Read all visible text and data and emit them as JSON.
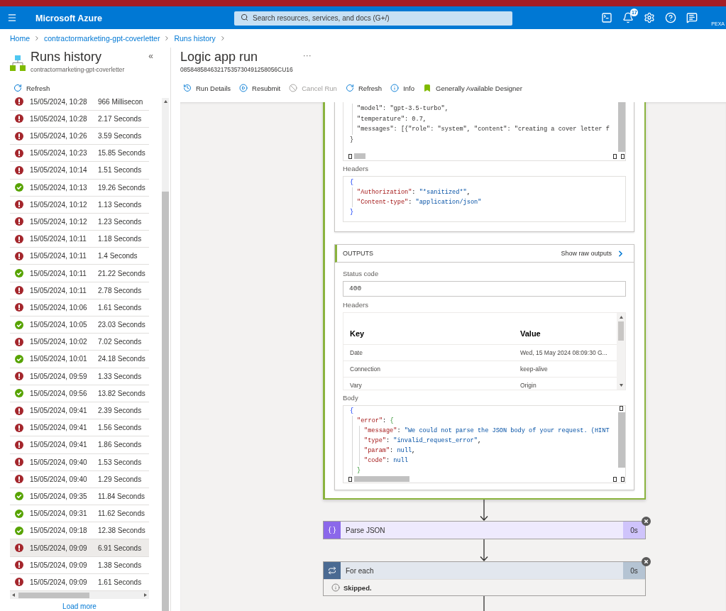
{
  "header": {
    "brand": "Microsoft Azure",
    "search": {
      "placeholder": "Search resources, services, and docs (G+/)"
    },
    "notification_count": "17",
    "account": "PEXA"
  },
  "breadcrumb": [
    "Home",
    "contractormarketing-gpt-coverletter",
    "Runs history"
  ],
  "runs_panel": {
    "title": "Runs history",
    "subtitle": "contractormarketing-gpt-coverletter",
    "collapse": "«",
    "refresh": "Refresh",
    "runs": [
      {
        "kind": "failed",
        "date": "15/05/2024, 10:28",
        "duration": "966 Millisecon",
        "selected": false
      },
      {
        "kind": "failed",
        "date": "15/05/2024, 10:28",
        "duration": "2.17 Seconds",
        "selected": false
      },
      {
        "kind": "failed",
        "date": "15/05/2024, 10:26",
        "duration": "3.59 Seconds",
        "selected": false
      },
      {
        "kind": "failed",
        "date": "15/05/2024, 10:23",
        "duration": "15.85 Seconds",
        "selected": false
      },
      {
        "kind": "failed",
        "date": "15/05/2024, 10:14",
        "duration": "1.51 Seconds",
        "selected": false
      },
      {
        "kind": "succeeded",
        "date": "15/05/2024, 10:13",
        "duration": "19.26 Seconds",
        "selected": false
      },
      {
        "kind": "failed",
        "date": "15/05/2024, 10:12",
        "duration": "1.13 Seconds",
        "selected": false
      },
      {
        "kind": "failed",
        "date": "15/05/2024, 10:12",
        "duration": "1.23 Seconds",
        "selected": false
      },
      {
        "kind": "failed",
        "date": "15/05/2024, 10:11",
        "duration": "1.18 Seconds",
        "selected": false
      },
      {
        "kind": "failed",
        "date": "15/05/2024, 10:11",
        "duration": "1.4 Seconds",
        "selected": false
      },
      {
        "kind": "succeeded",
        "date": "15/05/2024, 10:11",
        "duration": "21.22 Seconds",
        "selected": false
      },
      {
        "kind": "failed",
        "date": "15/05/2024, 10:11",
        "duration": "2.78 Seconds",
        "selected": false
      },
      {
        "kind": "failed",
        "date": "15/05/2024, 10:06",
        "duration": "1.61 Seconds",
        "selected": false
      },
      {
        "kind": "succeeded",
        "date": "15/05/2024, 10:05",
        "duration": "23.03 Seconds",
        "selected": false
      },
      {
        "kind": "failed",
        "date": "15/05/2024, 10:02",
        "duration": "7.02 Seconds",
        "selected": false
      },
      {
        "kind": "succeeded",
        "date": "15/05/2024, 10:01",
        "duration": "24.18 Seconds",
        "selected": false
      },
      {
        "kind": "failed",
        "date": "15/05/2024, 09:59",
        "duration": "1.33 Seconds",
        "selected": false
      },
      {
        "kind": "succeeded",
        "date": "15/05/2024, 09:56",
        "duration": "13.82 Seconds",
        "selected": false
      },
      {
        "kind": "failed",
        "date": "15/05/2024, 09:41",
        "duration": "2.39 Seconds",
        "selected": false
      },
      {
        "kind": "failed",
        "date": "15/05/2024, 09:41",
        "duration": "1.56 Seconds",
        "selected": false
      },
      {
        "kind": "failed",
        "date": "15/05/2024, 09:41",
        "duration": "1.86 Seconds",
        "selected": false
      },
      {
        "kind": "failed",
        "date": "15/05/2024, 09:40",
        "duration": "1.53 Seconds",
        "selected": false
      },
      {
        "kind": "failed",
        "date": "15/05/2024, 09:40",
        "duration": "1.29 Seconds",
        "selected": false
      },
      {
        "kind": "succeeded",
        "date": "15/05/2024, 09:35",
        "duration": "11.84 Seconds",
        "selected": false
      },
      {
        "kind": "succeeded",
        "date": "15/05/2024, 09:31",
        "duration": "11.62 Seconds",
        "selected": false
      },
      {
        "kind": "succeeded",
        "date": "15/05/2024, 09:18",
        "duration": "12.38 Seconds",
        "selected": false
      },
      {
        "kind": "failed",
        "date": "15/05/2024, 09:09",
        "duration": "6.91 Seconds",
        "selected": true
      },
      {
        "kind": "failed",
        "date": "15/05/2024, 09:09",
        "duration": "1.38 Seconds",
        "selected": false
      },
      {
        "kind": "failed",
        "date": "15/05/2024, 09:09",
        "duration": "1.61 Seconds",
        "selected": false
      }
    ],
    "load_more": "Load more"
  },
  "run": {
    "title": "Logic app run",
    "more": "···",
    "run_id": "08584858463217535730491258056CU16",
    "toolbar": [
      {
        "kind": "details",
        "label": "Run Details",
        "disabled": false
      },
      {
        "kind": "resubmit",
        "label": "Resubmit",
        "disabled": false
      },
      {
        "kind": "cancel",
        "label": "Cancel Run",
        "disabled": true
      },
      {
        "kind": "refresh",
        "label": "Refresh",
        "disabled": false
      },
      {
        "kind": "info",
        "label": "Info",
        "disabled": false
      },
      {
        "kind": "designer",
        "label": "Generally Available Designer",
        "disabled": false
      }
    ]
  },
  "inputs": {
    "body_code": [
      {
        "children": [
          {
            "tokens": [
              {
                "kind": "plain",
                "text": "\"model\": \"gpt-3.5-turbo\","
              }
            ]
          },
          {
            "tokens": [
              {
                "kind": "plain",
                "text": "\"temperature\": 0.7,"
              }
            ]
          },
          {
            "tokens": [
              {
                "kind": "plain",
                "text": "\"messages\": [{\"role\": \"system\", \"content\": \"creating a cover letter f"
              }
            ]
          }
        ]
      },
      {
        "tokens": [
          {
            "kind": "plain",
            "text": "}"
          }
        ]
      }
    ],
    "headers_label": "Headers",
    "headers_code": [
      {
        "tokens": [
          {
            "kind": "brace",
            "text": "{"
          }
        ],
        "children": [
          {
            "tokens": [
              {
                "kind": "key",
                "text": "\"Authorization\""
              },
              {
                "kind": "punct",
                "text": ": "
              },
              {
                "kind": "string",
                "text": "\"*sanitized*\""
              },
              {
                "kind": "punct",
                "text": ","
              }
            ]
          },
          {
            "tokens": [
              {
                "kind": "key",
                "text": "\"Content-type\""
              },
              {
                "kind": "punct",
                "text": ": "
              },
              {
                "kind": "string",
                "text": "\"application/json\""
              }
            ]
          }
        ]
      },
      {
        "tokens": [
          {
            "kind": "brace",
            "text": "}"
          }
        ]
      }
    ]
  },
  "outputs": {
    "title": "OUTPUTS",
    "raw_link": "Show raw outputs",
    "status_label": "Status code",
    "status_code": "400",
    "headers_label": "Headers",
    "headers_table": {
      "columns": [
        "Key",
        "Value"
      ],
      "rows": [
        [
          "Date",
          "Wed, 15 May 2024 08:09:30 G..."
        ],
        [
          "Connection",
          "keep-alive"
        ],
        [
          "Vary",
          "Origin"
        ]
      ]
    },
    "body_label": "Body",
    "body_code": [
      {
        "tokens": [
          {
            "kind": "brace",
            "text": "{"
          }
        ],
        "children": [
          {
            "tokens": [
              {
                "kind": "key",
                "text": "\"error\""
              },
              {
                "kind": "punct",
                "text": ": "
              },
              {
                "kind": "brace2",
                "text": "{"
              }
            ],
            "children": [
              {
                "tokens": [
                  {
                    "kind": "key",
                    "text": "\"message\""
                  },
                  {
                    "kind": "punct",
                    "text": ": "
                  },
                  {
                    "kind": "string",
                    "text": "\"We could not parse the JSON body of your request. (HINT"
                  }
                ]
              },
              {
                "tokens": [
                  {
                    "kind": "key",
                    "text": "\"type\""
                  },
                  {
                    "kind": "punct",
                    "text": ": "
                  },
                  {
                    "kind": "string",
                    "text": "\"invalid_request_error\""
                  },
                  {
                    "kind": "punct",
                    "text": ","
                  }
                ]
              },
              {
                "tokens": [
                  {
                    "kind": "key",
                    "text": "\"param\""
                  },
                  {
                    "kind": "punct",
                    "text": ": "
                  },
                  {
                    "kind": "null",
                    "text": "null"
                  },
                  {
                    "kind": "punct",
                    "text": ","
                  }
                ]
              },
              {
                "tokens": [
                  {
                    "kind": "key",
                    "text": "\"code\""
                  },
                  {
                    "kind": "punct",
                    "text": ": "
                  },
                  {
                    "kind": "null",
                    "text": "null"
                  }
                ]
              }
            ]
          },
          {
            "tokens": [
              {
                "kind": "brace2",
                "text": "}"
              }
            ]
          }
        ]
      }
    ]
  },
  "steps": [
    {
      "kind": "parse",
      "title": "Parse JSON",
      "duration": "0s"
    },
    {
      "kind": "foreach",
      "title": "For each",
      "duration": "0s",
      "note": "Skipped."
    }
  ]
}
